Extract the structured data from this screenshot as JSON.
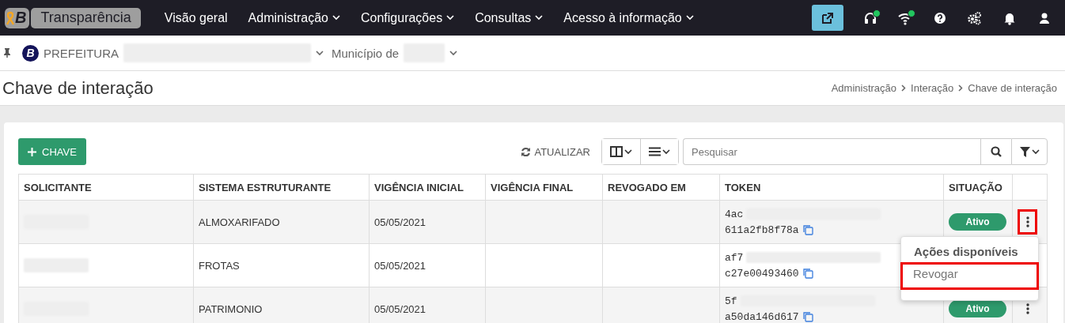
{
  "topbar": {
    "logo_letter": "B",
    "app_name": "Transparência",
    "menu": [
      {
        "label": "Visão geral",
        "dropdown": false
      },
      {
        "label": "Administração",
        "dropdown": true
      },
      {
        "label": "Configurações",
        "dropdown": true
      },
      {
        "label": "Consultas",
        "dropdown": true
      },
      {
        "label": "Acesso à informação",
        "dropdown": true
      }
    ],
    "tools": [
      {
        "kind": "external-link",
        "online": false
      },
      {
        "kind": "headset",
        "online": true
      },
      {
        "kind": "wifi",
        "online": true
      },
      {
        "kind": "help",
        "online": false
      },
      {
        "kind": "settings",
        "online": false
      },
      {
        "kind": "notifications",
        "online": false
      },
      {
        "kind": "user",
        "online": false
      }
    ]
  },
  "context_bar": {
    "org_letter": "B",
    "org_label": "PREFEITURA",
    "municipality_label": "Município de"
  },
  "page": {
    "title": "Chave de interação",
    "breadcrumb": [
      "Administração",
      "Interação",
      "Chave de interação"
    ]
  },
  "toolbar": {
    "add_button": "CHAVE",
    "refresh_button": "ATUALIZAR",
    "search": {
      "placeholder": "Pesquisar"
    }
  },
  "table": {
    "columns": [
      "SOLICITANTE",
      "SISTEMA ESTRUTURANTE",
      "VIGÊNCIA INICIAL",
      "VIGÊNCIA FINAL",
      "REVOGADO EM",
      "TOKEN",
      "SITUAÇÃO"
    ],
    "rows": [
      {
        "sistema": "ALMOXARIFADO",
        "vigencia_inicial": "05/05/2021",
        "token_start": "4ac",
        "token_end": "611a2fb8f78a",
        "status": "Ativo",
        "menu_highlighted": true
      },
      {
        "sistema": "FROTAS",
        "vigencia_inicial": "05/05/2021",
        "token_start": "af7",
        "token_end": "c27e00493460"
      },
      {
        "sistema": "PATRIMONIO",
        "vigencia_inicial": "05/05/2021",
        "token_start": "5f",
        "token_end": "a50da146d617",
        "status": "Ativo",
        "menu_highlighted": false
      }
    ]
  },
  "action_menu": {
    "title": "Ações disponíveis",
    "items": [
      {
        "label": "Revogar",
        "highlighted": true
      }
    ]
  }
}
